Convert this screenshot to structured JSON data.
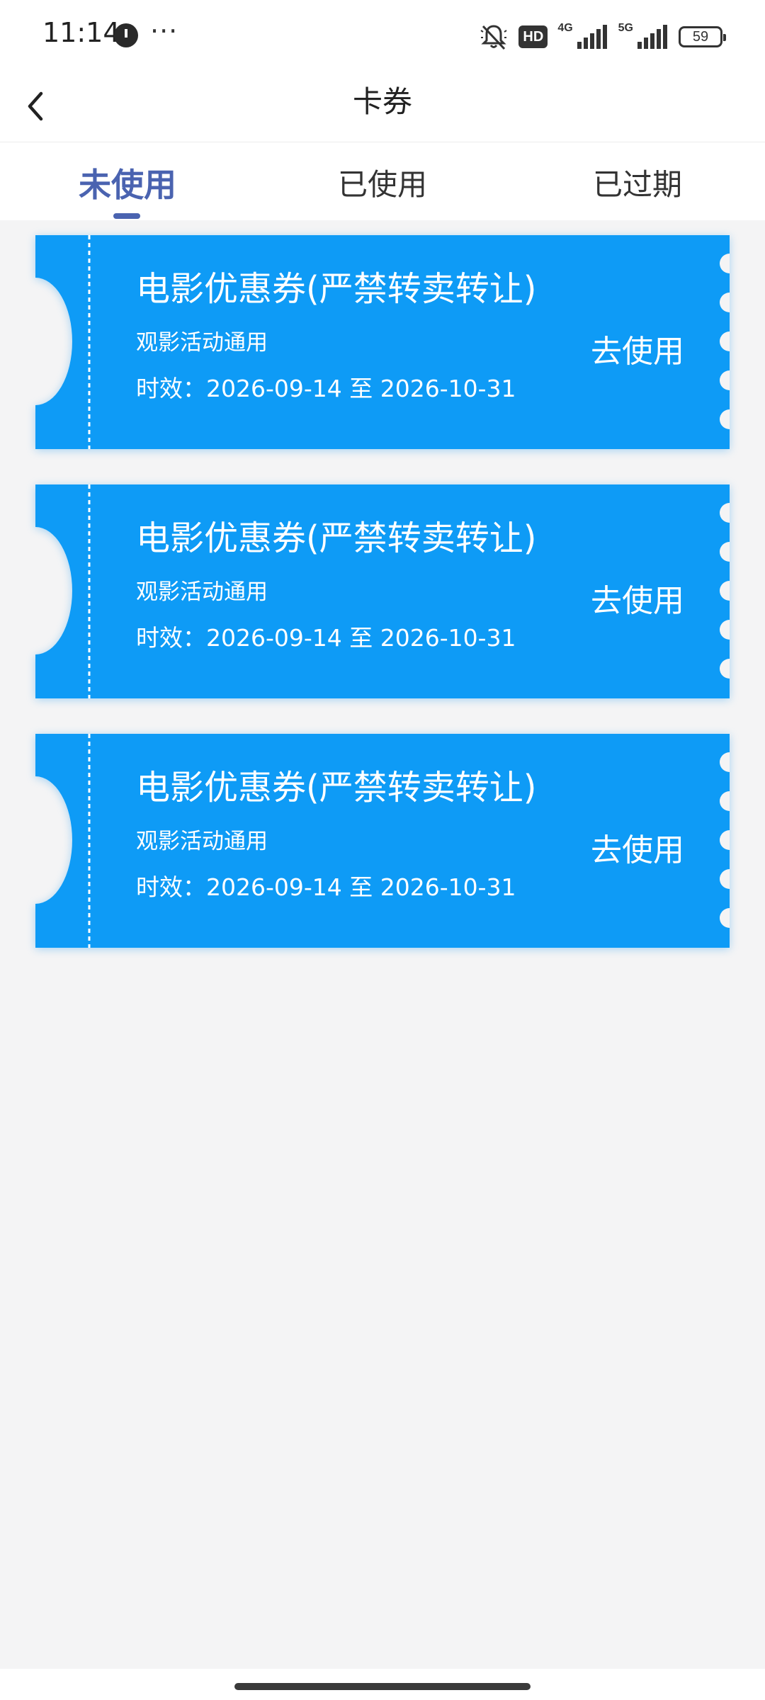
{
  "status_bar": {
    "time": "11:14",
    "more": "···",
    "hd_label": "HD",
    "network_1": "4G",
    "network_2": "5G",
    "battery": "59"
  },
  "nav": {
    "title": "卡券",
    "back_icon": "chevron-left-icon"
  },
  "tabs": [
    {
      "label": "未使用",
      "active": true
    },
    {
      "label": "已使用",
      "active": false
    },
    {
      "label": "已过期",
      "active": false
    }
  ],
  "coupons": [
    {
      "title": "电影优惠券(严禁转卖转让)",
      "description": "观影活动通用",
      "validity": "时效：2026-09-14 至 2026-10-31",
      "action": "去使用"
    },
    {
      "title": "电影优惠券(严禁转卖转让)",
      "description": "观影活动通用",
      "validity": "时效：2026-09-14 至 2026-10-31",
      "action": "去使用"
    },
    {
      "title": "电影优惠券(严禁转卖转让)",
      "description": "观影活动通用",
      "validity": "时效：2026-09-14 至 2026-10-31",
      "action": "去使用"
    }
  ],
  "colors": {
    "accent": "#4a63b0",
    "coupon": "#0e9bf6",
    "background": "#f4f4f5"
  }
}
